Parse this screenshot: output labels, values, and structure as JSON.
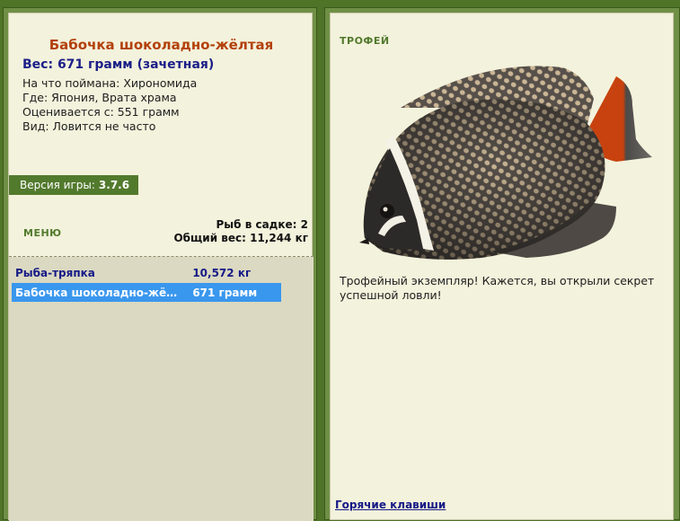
{
  "catch_info": {
    "fish_name": "Бабочка шоколадно-жёлтая",
    "weight_line": "Вес: 671 грамм (зачетная)",
    "bait_line": "На что поймана: Хирономида",
    "location_line": "Где: Япония, Врата храма",
    "value_line": "Оценивается с: 551 грамм",
    "rarity_line": "Вид: Ловится не часто"
  },
  "version": {
    "label": "Версия игры:",
    "value": "3.7.6"
  },
  "menu": {
    "label": "МЕНЮ"
  },
  "stats": {
    "count_line": "Рыб в садке: 2",
    "total_line": "Общий вес: 11,244 кг"
  },
  "catch_list": [
    {
      "name": "Рыба-тряпка",
      "weight": "10,572 кг",
      "selected": false
    },
    {
      "name": "Бабочка шоколадно-жё…",
      "weight": "671 грамм",
      "selected": true
    }
  ],
  "trophy": {
    "label": "ТРОФЕЙ",
    "fish_image": "butterflyfish-icon",
    "message": "Трофейный экземпляр! Кажется, вы открыли секрет успешной ловли!"
  },
  "hotkeys": {
    "label": "Горячие клавиши"
  },
  "colors": {
    "background": "#4f7327",
    "panel": "#f3f2dc",
    "fish_name": "#b3410b",
    "accent_green": "#527a2d",
    "selected_row": "#3a97ee",
    "link_blue": "#161a87"
  }
}
